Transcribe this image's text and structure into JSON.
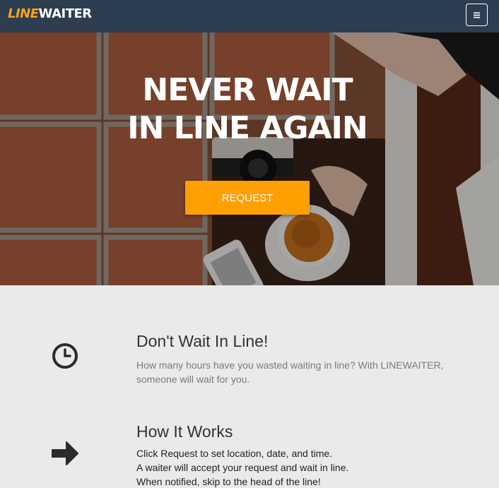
{
  "navbar": {
    "brand_part1": "LINE",
    "brand_part2": "WAITER",
    "menu_icon": "hamburger-icon",
    "colors": {
      "background": "#2c3e50",
      "brand_accent": "#f7a21b"
    }
  },
  "hero": {
    "title_line1": "NEVER WAIT",
    "title_line2": "IN LINE AGAIN",
    "request_label": "REQUEST",
    "colors": {
      "button": "#fea002"
    }
  },
  "features": [
    {
      "icon": "clock-icon",
      "title": "Don't Wait In Line!",
      "description": "How many hours have you wasted waiting in line? With LINEWAITER, someone will wait for you."
    },
    {
      "icon": "arrow-right-icon",
      "title": "How It Works",
      "lines": [
        "Click Request to set location, date, and time.",
        "A waiter will accept your request and wait in line.",
        "When notified, skip to the head of the line!"
      ]
    }
  ]
}
